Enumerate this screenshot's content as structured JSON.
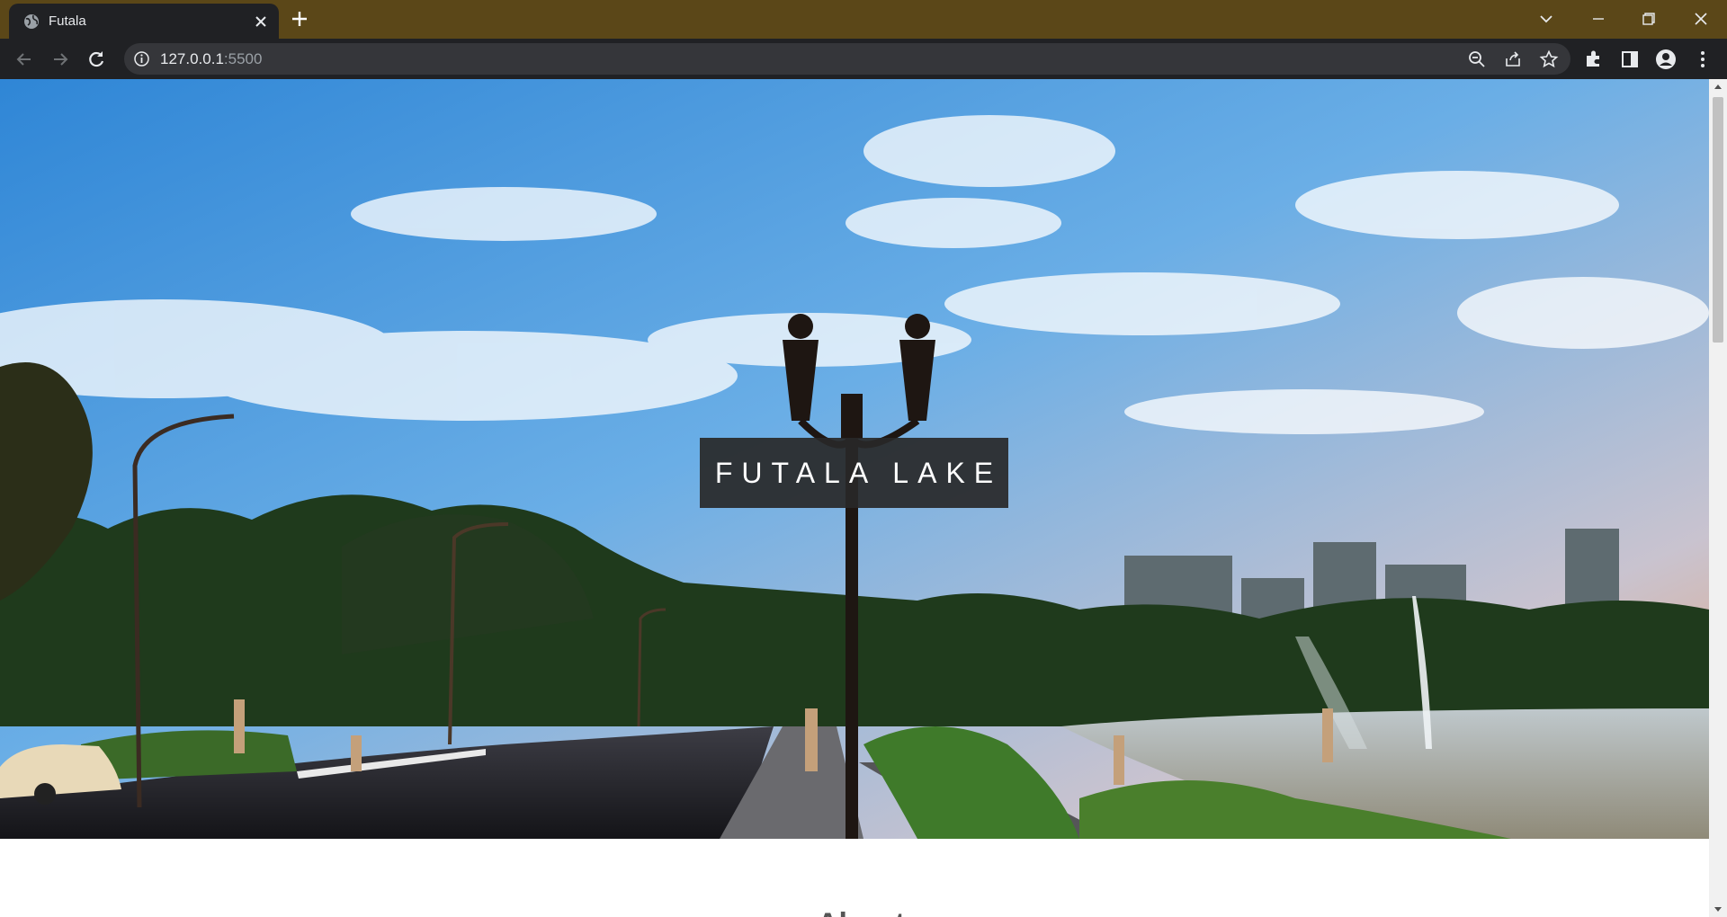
{
  "browser": {
    "tab": {
      "title": "Futala",
      "favicon": "globe-icon"
    },
    "address": {
      "host": "127.0.0.1",
      "port": ":5500"
    },
    "omnibox_icons": [
      "site-info-icon",
      "zoom-icon",
      "share-icon",
      "bookmark-star-icon"
    ],
    "toolbar_icons": [
      "extensions-icon",
      "side-panel-icon",
      "profile-icon",
      "menu-icon"
    ],
    "window_controls": [
      "tab-search-icon",
      "minimize-icon",
      "restore-icon",
      "close-icon"
    ],
    "frame_color": "#5b4718"
  },
  "page": {
    "hero": {
      "title": "FUTALA LAKE",
      "image": "lakeside-promenade-photo"
    },
    "next_section_heading": "About"
  }
}
